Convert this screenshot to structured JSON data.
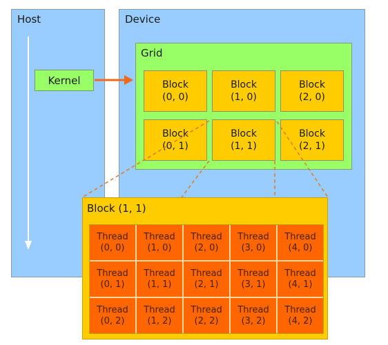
{
  "host": {
    "label": "Host"
  },
  "device": {
    "label": "Device"
  },
  "kernel": {
    "label": "Kernel"
  },
  "grid": {
    "label": "Grid",
    "blocks": [
      {
        "name": "Block",
        "coord": "(0, 0)"
      },
      {
        "name": "Block",
        "coord": "(1, 0)"
      },
      {
        "name": "Block",
        "coord": "(2, 0)"
      },
      {
        "name": "Block",
        "coord": "(0, 1)"
      },
      {
        "name": "Block",
        "coord": "(1, 1)"
      },
      {
        "name": "Block",
        "coord": "(2, 1)"
      }
    ]
  },
  "block_detail": {
    "label": "Block (1, 1)",
    "threads": [
      {
        "name": "Thread",
        "coord": "(0, 0)"
      },
      {
        "name": "Thread",
        "coord": "(1, 0)"
      },
      {
        "name": "Thread",
        "coord": "(2, 0)"
      },
      {
        "name": "Thread",
        "coord": "(3, 0)"
      },
      {
        "name": "Thread",
        "coord": "(4, 0)"
      },
      {
        "name": "Thread",
        "coord": "(0, 1)"
      },
      {
        "name": "Thread",
        "coord": "(1, 1)"
      },
      {
        "name": "Thread",
        "coord": "(2, 1)"
      },
      {
        "name": "Thread",
        "coord": "(3, 1)"
      },
      {
        "name": "Thread",
        "coord": "(4, 1)"
      },
      {
        "name": "Thread",
        "coord": "(0, 2)"
      },
      {
        "name": "Thread",
        "coord": "(1, 2)"
      },
      {
        "name": "Thread",
        "coord": "(2, 2)"
      },
      {
        "name": "Thread",
        "coord": "(3, 2)"
      },
      {
        "name": "Thread",
        "coord": "(4, 2)"
      }
    ]
  },
  "colors": {
    "panel": "#99ccff",
    "grid": "#99ff66",
    "block": "#ffcc00",
    "thread": "#ff6600",
    "arrow": "#ee6a1a"
  }
}
